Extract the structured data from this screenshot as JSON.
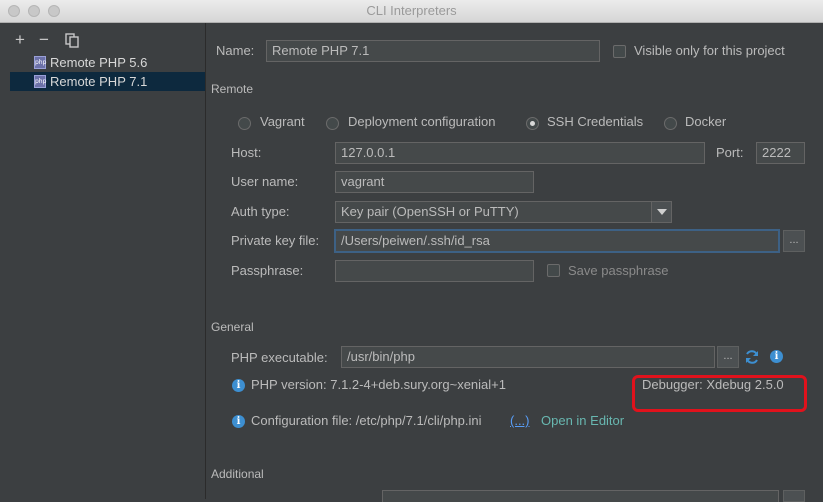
{
  "window": {
    "title": "CLI Interpreters"
  },
  "toolbar": {
    "add": "+",
    "remove": "−",
    "copy_icon": "copy-icon"
  },
  "tree": {
    "items": [
      {
        "label": "Remote PHP 5.6",
        "icon_text": "php"
      },
      {
        "label": "Remote PHP 7.1",
        "icon_text": "php"
      }
    ]
  },
  "form": {
    "name_label": "Name:",
    "name_value": "Remote PHP 7.1",
    "visible_only_label": "Visible only for this project",
    "remote_section": "Remote",
    "radios": [
      {
        "label": "Vagrant",
        "selected": false
      },
      {
        "label": "Deployment configuration",
        "selected": false
      },
      {
        "label": "SSH Credentials",
        "selected": true
      },
      {
        "label": "Docker",
        "selected": false
      }
    ],
    "host_label": "Host:",
    "host_value": "127.0.0.1",
    "port_label": "Port:",
    "port_value": "2222",
    "username_label": "User name:",
    "username_value": "vagrant",
    "auth_label": "Auth type:",
    "auth_value": "Key pair (OpenSSH or PuTTY)",
    "keyfile_label": "Private key file:",
    "keyfile_value": "/Users/peiwen/.ssh/id_rsa",
    "browse_label": "...",
    "passphrase_label": "Passphrase:",
    "passphrase_value": "",
    "save_passphrase_label": "Save passphrase",
    "general_section": "General",
    "php_exec_label": "PHP executable:",
    "php_exec_value": "/usr/bin/php",
    "php_version_text": "PHP version: 7.1.2-4+deb.sury.org~xenial+1",
    "debugger_text": "Debugger: Xdebug 2.5.0",
    "config_file_text": "Configuration file: /etc/php/7.1/cli/php.ini",
    "config_more_link": "(...)",
    "open_editor_link": "Open in Editor",
    "additional_section": "Additional"
  },
  "colors": {
    "highlight": "#e1121c",
    "accent": "#3d8fd1",
    "selection": "#0d293e"
  }
}
